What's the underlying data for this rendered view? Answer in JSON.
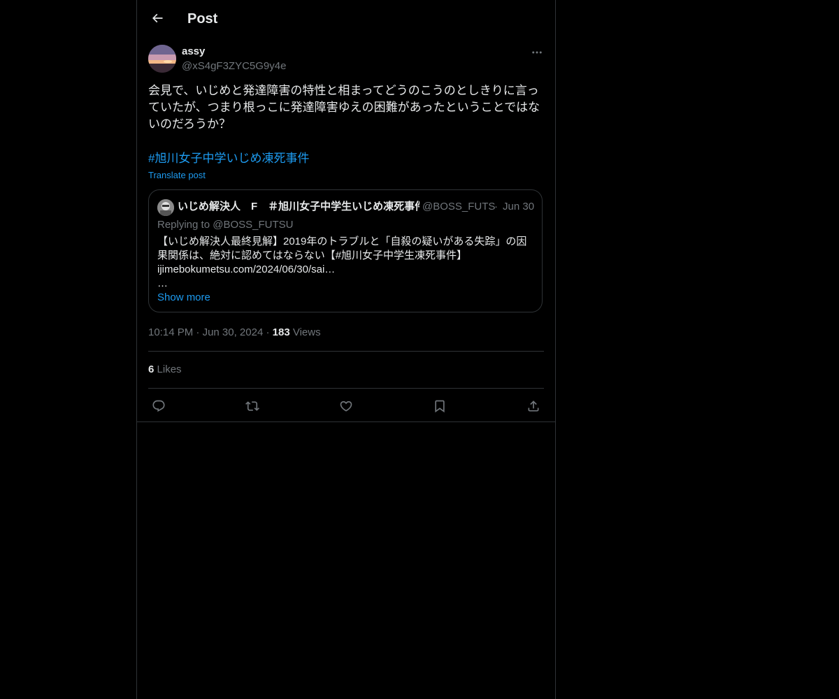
{
  "header": {
    "back_icon": "arrow-left-icon",
    "title": "Post"
  },
  "author": {
    "display_name": "assy",
    "handle": "@xS4gF3ZYC5G9y4e",
    "more_icon": "more-horizontal-icon"
  },
  "post": {
    "text": "会見で、いじめと発達障害の特性と相まってどうのこうのとしきりに言っていたが、つまり根っこに発達障害ゆえの困難があったということではないのだろうか？",
    "hashtag": "#旭川女子中学いじめ凍死事件",
    "translate_label": "Translate post"
  },
  "quote": {
    "display_name": "いじめ解決人　F　＃旭川女子中学生いじめ凍死事件",
    "handle": "@BOSS_FUTS",
    "separator": "·",
    "date": "Jun 30",
    "replying_to": "Replying to @BOSS_FUTSU",
    "text": "【いじめ解決人最終見解】2019年のトラブルと「自殺の疑いがある失踪」の因果関係は、絶対に認めてはならない【#旭川女子中学生凍死事件】\nijimebokumetsu.com/2024/06/30/sai…\n…",
    "show_more": "Show more"
  },
  "meta": {
    "time": "10:14 PM",
    "sep1": "·",
    "date": "Jun 30, 2024",
    "sep2": "·",
    "views_count": "183",
    "views_label": "Views"
  },
  "stats": {
    "likes_count": "6",
    "likes_label": "Likes"
  },
  "actions": {
    "reply_icon": "reply-icon",
    "repost_icon": "repost-icon",
    "like_icon": "heart-icon",
    "bookmark_icon": "bookmark-icon",
    "share_icon": "share-icon"
  },
  "colors": {
    "background": "#000000",
    "text": "#e7e9ea",
    "secondary": "#71767b",
    "accent": "#1d9bf0",
    "border": "#2f3336"
  }
}
